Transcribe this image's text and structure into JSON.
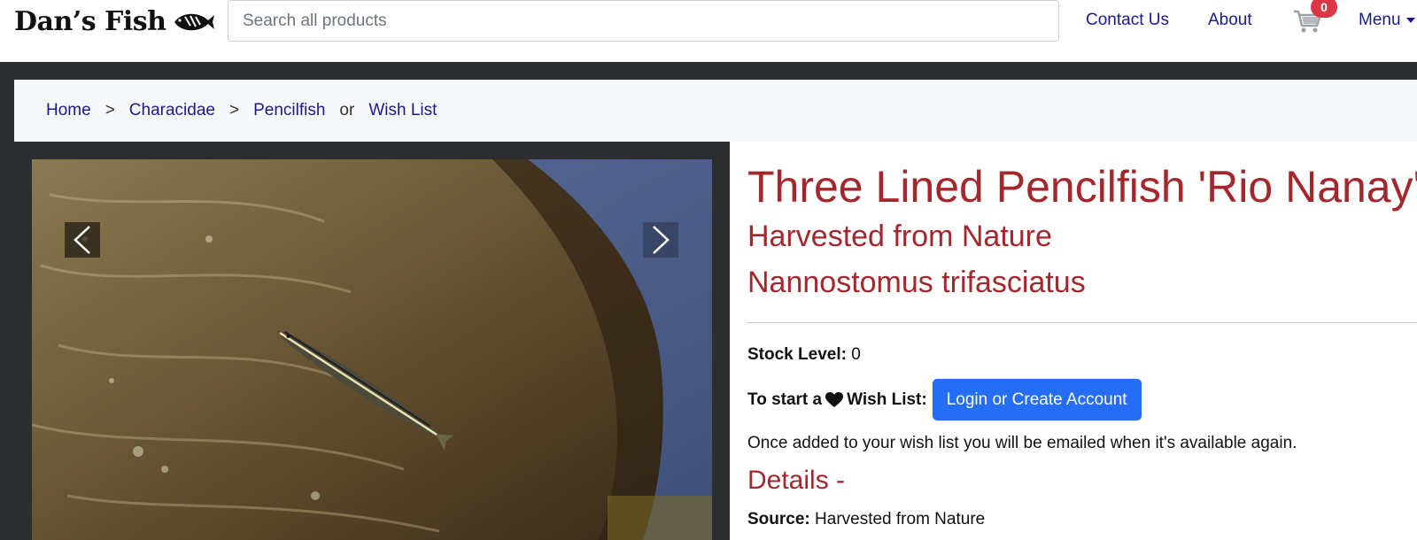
{
  "navbar": {
    "brand": "Dan’s Fish",
    "brand_icon": "fish-logo-icon",
    "search_placeholder": "Search all products",
    "links": {
      "contact": "Contact Us",
      "about": "About",
      "menu": "Menu"
    },
    "cart_icon": "shopping-cart-icon",
    "cart_count": "0"
  },
  "breadcrumb": {
    "items": [
      "Home",
      "Characidae",
      "Pencilfish"
    ],
    "separator": ">",
    "or_text": "or",
    "wishlist": "Wish List"
  },
  "product": {
    "title": "Three Lined Pencilfish 'Rio Nanay'",
    "origin": "Harvested from Nature",
    "scientific_name": "Nannostomus trifasciatus",
    "stock_label": "Stock Level:",
    "stock_value": "0",
    "wish_prefix": "To start a",
    "wish_icon": "heart-icon",
    "wish_suffix": "Wish List:",
    "login_button": "Login or Create Account",
    "wish_note": "Once added to your wish list you will be emailed when it's available again.",
    "details_heading": "Details -",
    "source_label": "Source:",
    "source_value": "Harvested from Nature"
  },
  "gallery": {
    "prev_icon": "chevron-left-icon",
    "next_icon": "chevron-right-icon"
  },
  "colors": {
    "accent_red": "#a3272c",
    "link_blue": "#1a1a8c",
    "button_blue": "#256df5",
    "badge_red": "#dc3545",
    "page_dark": "#2b2d2f"
  }
}
